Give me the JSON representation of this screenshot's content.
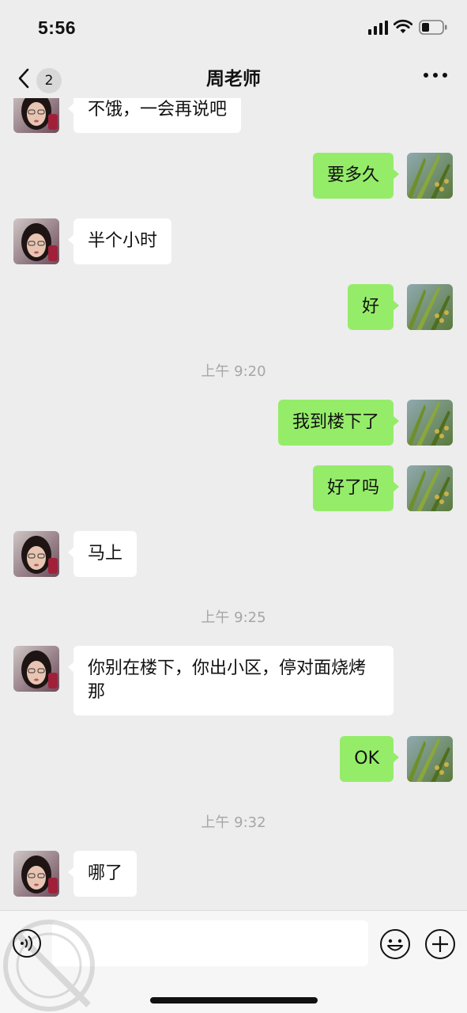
{
  "status_bar": {
    "time": "5:56",
    "icons": [
      "cellular-signal-icon",
      "wifi-icon",
      "battery-icon"
    ]
  },
  "nav": {
    "back_icon": "chevron-left-icon",
    "unread_count": "2",
    "title": "周老师",
    "more_icon": "more-dots-icon"
  },
  "messages": [
    {
      "from": "teacher",
      "text": "不饿，一会再说吧"
    },
    {
      "from": "me",
      "text": "要多久"
    },
    {
      "from": "teacher",
      "text": "半个小时"
    },
    {
      "from": "me",
      "text": "好"
    },
    {
      "type": "time",
      "text": "上午 9:20"
    },
    {
      "from": "me",
      "text": "我到楼下了"
    },
    {
      "from": "me",
      "text": "好了吗"
    },
    {
      "from": "teacher",
      "text": "马上"
    },
    {
      "type": "time",
      "text": "上午 9:25"
    },
    {
      "from": "teacher",
      "text": "你别在楼下，你出小区，停对面烧烤那"
    },
    {
      "from": "me",
      "text": "OK"
    },
    {
      "type": "time",
      "text": "上午 9:32"
    },
    {
      "from": "teacher",
      "text": "哪了"
    }
  ],
  "input_bar": {
    "voice_icon": "voice-icon",
    "input_value": "",
    "emoji_icon": "emoji-icon",
    "plus_icon": "plus-icon"
  },
  "colors": {
    "background": "#ededed",
    "bubble_sent": "#95ec69",
    "bubble_received": "#ffffff",
    "timestamp": "#a6a6a6"
  }
}
